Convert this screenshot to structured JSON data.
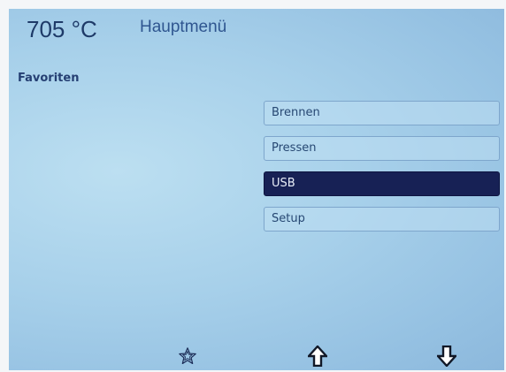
{
  "header": {
    "temperature": "705 °C",
    "title": "Hauptmenü"
  },
  "favorites": {
    "label": "Favoriten"
  },
  "menu": {
    "items": [
      {
        "label": "Brennen",
        "selected": false
      },
      {
        "label": "Pressen",
        "selected": false
      },
      {
        "label": "USB",
        "selected": true
      },
      {
        "label": "Setup",
        "selected": false
      }
    ]
  },
  "softkeys": [
    {
      "icon": "star-icon"
    },
    {
      "icon": "arrow-up-icon"
    },
    {
      "icon": "arrow-down-icon"
    }
  ],
  "colors": {
    "screen_background": "#a7d0ea",
    "text": "#1e3a68",
    "selected_background": "#172155",
    "selected_text": "#e9eef8",
    "item_border": "#7ea6cc"
  }
}
